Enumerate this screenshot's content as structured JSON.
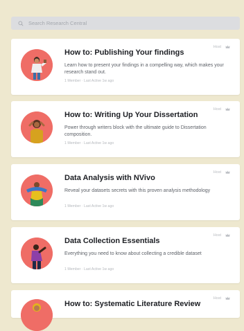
{
  "search": {
    "placeholder": "Search Research Central"
  },
  "cards": [
    {
      "title": "How to: Publishing Your findings",
      "description": "Learn how to present your findings in a compelling way, which makes your research stand out.",
      "meta": "1 Member · Last Active 1w ago",
      "host": "Host",
      "avatar_bg": "#ef6d66"
    },
    {
      "title": "How to: Writing Up Your Dissertation",
      "description": "Power through writers block with the ultimate guide to Dissertation composition.",
      "meta": "1 Member · Last Active 1w ago",
      "host": "Host",
      "avatar_bg": "#ef6d66"
    },
    {
      "title": "Data Analysis with NVivo",
      "description": "Reveal your datasets secrets with this proven analysis methodology",
      "meta": "1 Member · Last Active 1w ago",
      "host": "Host",
      "avatar_bg": "#ef6d66"
    },
    {
      "title": "Data Collection Essentials",
      "description": "Everything you need to know about collecting a credible dataset",
      "meta": "1 Member · Last Active 1w ago",
      "host": "Host",
      "avatar_bg": "#ef6d66"
    },
    {
      "title": "How to: Systematic Literature Review",
      "description": "",
      "meta": "",
      "host": "Host",
      "avatar_bg": "#ef6d66"
    }
  ],
  "icons": {
    "search": "search-icon",
    "host": "crown-icon"
  },
  "colors": {
    "background": "#eee8cf",
    "card": "#ffffff",
    "avatar": "#ef6d66",
    "search_bar": "#dcdde0"
  }
}
